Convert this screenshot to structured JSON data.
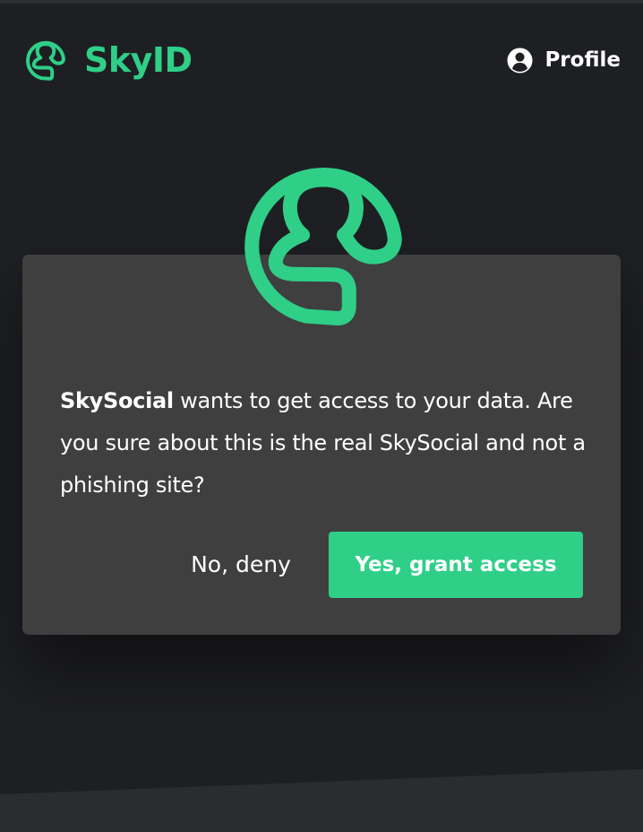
{
  "header": {
    "brand_name": "SkyID",
    "brand_icon": "skyid-logo-icon",
    "profile_label": "Profile",
    "profile_icon": "user-circle-icon"
  },
  "dialog": {
    "logo_icon": "skyid-logo-icon",
    "app_name": "SkySocial",
    "message_rest": " wants to get access to your data. Are you sure about this is the real SkySocial and not a phishing site?",
    "deny_label": "No, deny",
    "grant_label": "Yes, grant access"
  },
  "colors": {
    "accent": "#2fcf88",
    "background": "#1e1f23",
    "dialog_background": "#3f3f3f",
    "text": "#ffffff"
  }
}
